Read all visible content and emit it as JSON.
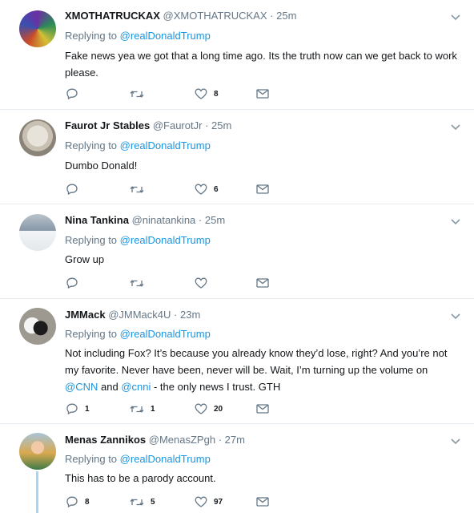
{
  "tweets": [
    {
      "name": "XMOTHATRUCKAX",
      "handle": "@XMOTHATRUCKAX",
      "sep": "·",
      "time": "25m",
      "reply_prefix": "Replying to",
      "reply_to": "@realDonaldTrump",
      "text": "Fake news yea we got that a long time ago. Its the truth now can we get back to work please.",
      "reply_count": "",
      "retweet_count": "",
      "like_count": "8"
    },
    {
      "name": "Faurot Jr Stables",
      "handle": "@FaurotJr",
      "sep": "·",
      "time": "25m",
      "reply_prefix": "Replying to",
      "reply_to": "@realDonaldTrump",
      "text": "Dumbo Donald!",
      "reply_count": "",
      "retweet_count": "",
      "like_count": "6"
    },
    {
      "name": "Nina Tankina",
      "handle": "@ninatankina",
      "sep": "·",
      "time": "25m",
      "reply_prefix": "Replying to",
      "reply_to": "@realDonaldTrump",
      "text": "Grow up",
      "reply_count": "",
      "retweet_count": "",
      "like_count": ""
    },
    {
      "name": "JMMack",
      "handle": "@JMMack4U",
      "sep": "·",
      "time": "23m",
      "reply_prefix": "Replying to",
      "reply_to": "@realDonaldTrump",
      "text_part1": "Not including Fox?  It’s because you already know they’d lose, right?  And you’re not my favorite. Never have been, never will be. Wait, I’m turning up the volume on",
      "mention1": "@CNN",
      "text_and": "and",
      "mention2": "@cnni",
      "text_part2": " - the only news I trust. GTH",
      "reply_count": "1",
      "retweet_count": "1",
      "like_count": "20"
    },
    {
      "name": "Menas Zannikos",
      "handle": "@MenasZPgh",
      "sep": "·",
      "time": "27m",
      "reply_prefix": "Replying to",
      "reply_to": "@realDonaldTrump",
      "text": "This has to be a parody account.",
      "reply_count": "8",
      "retweet_count": "5",
      "like_count": "97"
    }
  ],
  "colors": {
    "link": "#1b95e0",
    "muted": "#657786",
    "text": "#14171a",
    "divider": "#e6ecf0",
    "thread_line": "#a7d6f5"
  },
  "icons": [
    "reply-icon",
    "retweet-icon",
    "like-icon",
    "direct-message-icon",
    "chevron-down-icon"
  ]
}
